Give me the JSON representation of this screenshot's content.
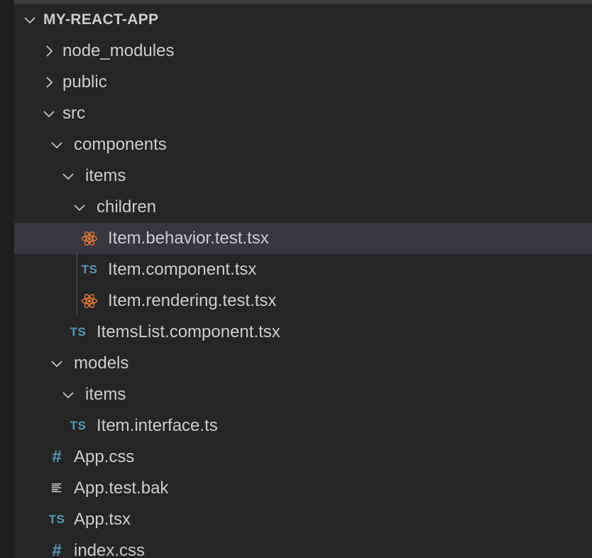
{
  "explorer": {
    "project_title": "MY-REACT-APP",
    "tree": [
      {
        "label": "node_modules",
        "kind": "folder",
        "expanded": false,
        "depth": 0,
        "icon": "chevron-right-icon"
      },
      {
        "label": "public",
        "kind": "folder",
        "expanded": false,
        "depth": 0,
        "icon": "chevron-right-icon"
      },
      {
        "label": "src",
        "kind": "folder",
        "expanded": true,
        "depth": 0,
        "icon": "chevron-down-icon"
      },
      {
        "label": "components",
        "kind": "folder",
        "expanded": true,
        "depth": 1,
        "icon": "chevron-down-icon"
      },
      {
        "label": "items",
        "kind": "folder",
        "expanded": true,
        "depth": 2,
        "icon": "chevron-down-icon"
      },
      {
        "label": "children",
        "kind": "folder",
        "expanded": true,
        "depth": 3,
        "icon": "chevron-down-icon"
      },
      {
        "label": "Item.behavior.test.tsx",
        "kind": "file",
        "depth": 4,
        "icon": "react-icon",
        "selected": true
      },
      {
        "label": "Item.component.tsx",
        "kind": "file",
        "depth": 4,
        "icon": "typescript-icon",
        "icon_text": "TS"
      },
      {
        "label": "Item.rendering.test.tsx",
        "kind": "file",
        "depth": 4,
        "icon": "react-icon"
      },
      {
        "label": "ItemsList.component.tsx",
        "kind": "file",
        "depth": 3,
        "icon": "typescript-icon",
        "icon_text": "TS"
      },
      {
        "label": "models",
        "kind": "folder",
        "expanded": true,
        "depth": 1,
        "icon": "chevron-down-icon"
      },
      {
        "label": "items",
        "kind": "folder",
        "expanded": true,
        "depth": 2,
        "icon": "chevron-down-icon"
      },
      {
        "label": "Item.interface.ts",
        "kind": "file",
        "depth": 3,
        "icon": "typescript-icon",
        "icon_text": "TS"
      },
      {
        "label": "App.css",
        "kind": "file",
        "depth": 1,
        "icon": "css-hash-icon",
        "icon_text": "#"
      },
      {
        "label": "App.test.bak",
        "kind": "file",
        "depth": 1,
        "icon": "text-lines-icon"
      },
      {
        "label": "App.tsx",
        "kind": "file",
        "depth": 1,
        "icon": "typescript-icon",
        "icon_text": "TS"
      },
      {
        "label": "index.css",
        "kind": "file",
        "depth": 1,
        "icon": "css-hash-icon",
        "icon_text": "#"
      }
    ]
  },
  "colors": {
    "background": "#252526",
    "text": "#cccccc",
    "selected_row": "#37373d",
    "typescript_icon": "#519aba",
    "react_icon": "#e37933",
    "chevron": "#c5c5c5"
  }
}
